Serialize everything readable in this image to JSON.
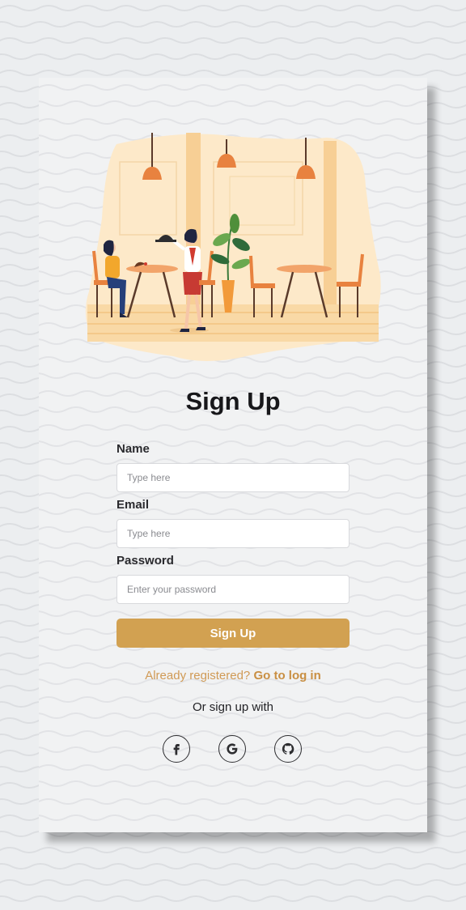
{
  "signup": {
    "title": "Sign Up",
    "name_label": "Name",
    "name_placeholder": "Type here",
    "email_label": "Email",
    "email_placeholder": "Type here",
    "password_label": "Password",
    "password_placeholder": "Enter your password",
    "submit_label": "Sign Up",
    "already_registered": "Already registered?",
    "login_link": "Go to log in",
    "or_text": "Or sign up with"
  },
  "social": {
    "icons": [
      "facebook-icon",
      "google-icon",
      "github-icon"
    ]
  },
  "colors": {
    "accent": "#d2a151",
    "link": "#c98f43",
    "text_dark": "#17171a"
  }
}
